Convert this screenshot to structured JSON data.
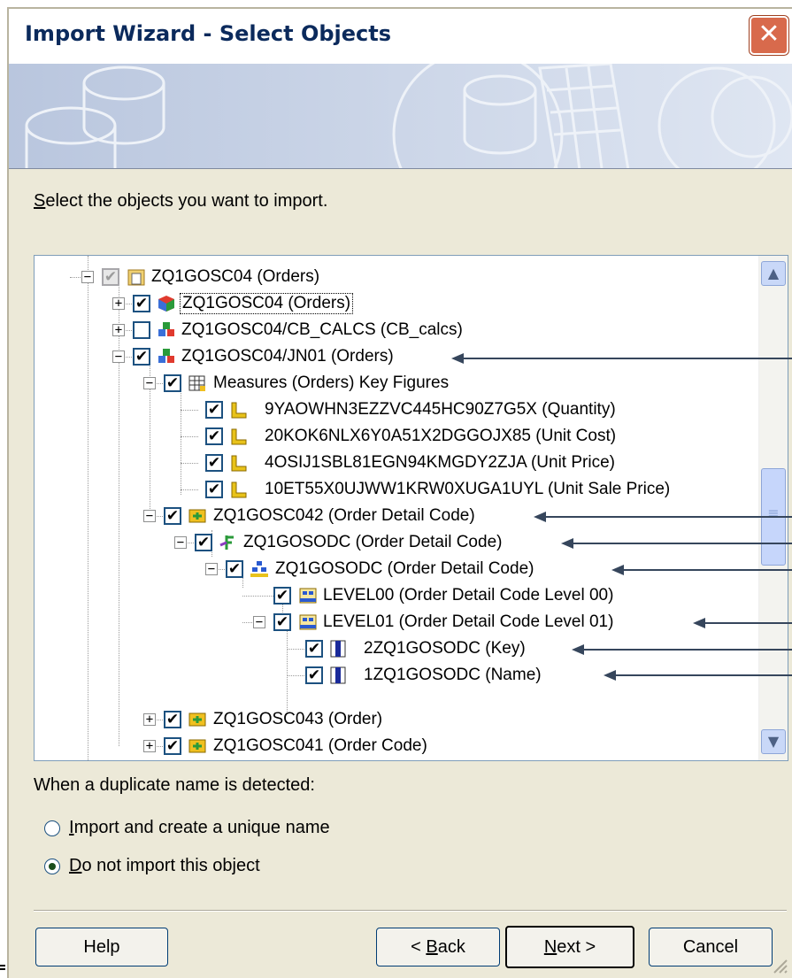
{
  "window": {
    "title": "Import Wizard - Select Objects",
    "close_label": "✕"
  },
  "instruction": {
    "mnemonic": "S",
    "rest": "elect the objects you want to import."
  },
  "tree": {
    "nodes": [
      {
        "text": "ZQ1GOSC04 (Orders)"
      },
      {
        "text": "ZQ1GOSC04 (Orders)"
      },
      {
        "text": "ZQ1GOSC04/CB_CALCS (CB_calcs)"
      },
      {
        "text": "ZQ1GOSC04/JN01 (Orders)"
      },
      {
        "text": "Measures (Orders) Key Figures"
      },
      {
        "text": "9YAOWHN3EZZVC445HC90Z7G5X (Quantity)"
      },
      {
        "text": "20KOK6NLX6Y0A51X2DGGOJX85 (Unit Cost)"
      },
      {
        "text": "4OSIJ1SBL81EGN94KMGDY2ZJA (Unit Price)"
      },
      {
        "text": "10ET55X0UJWW1KRW0XUGA1UYL (Unit Sale Price)"
      },
      {
        "text": "ZQ1GOSC042 (Order Detail Code)"
      },
      {
        "text": "ZQ1GOSODC (Order Detail Code)"
      },
      {
        "text": "ZQ1GOSODC (Order Detail Code)"
      },
      {
        "text": "LEVEL00 (Order Detail Code Level 00)"
      },
      {
        "text": "LEVEL01 (Order Detail Code Level 01)"
      },
      {
        "text": "2ZQ1GOSODC (Key)"
      },
      {
        "text": "1ZQ1GOSODC (Name)"
      },
      {
        "text": "ZQ1GOSC043 (Order)"
      },
      {
        "text": "ZQ1GOSC041 (Order Code)"
      }
    ]
  },
  "duplicate": {
    "label": "When a duplicate name is detected:",
    "option1": {
      "mnemonic": "I",
      "rest": "mport and create a unique name",
      "selected": false
    },
    "option2": {
      "mnemonic": "D",
      "rest": "o not import this object",
      "selected": true
    }
  },
  "buttons": {
    "help": "Help",
    "back_prefix": "< ",
    "back_mnemonic": "B",
    "back_rest": "ack",
    "next_mnemonic": "N",
    "next_rest": "ext >",
    "cancel": "Cancel"
  },
  "colors": {
    "title_text": "#0b2a5c",
    "close_button": "#d86a4c",
    "banner": "#c8d3e6",
    "dialog_bg": "#ece9d8"
  }
}
